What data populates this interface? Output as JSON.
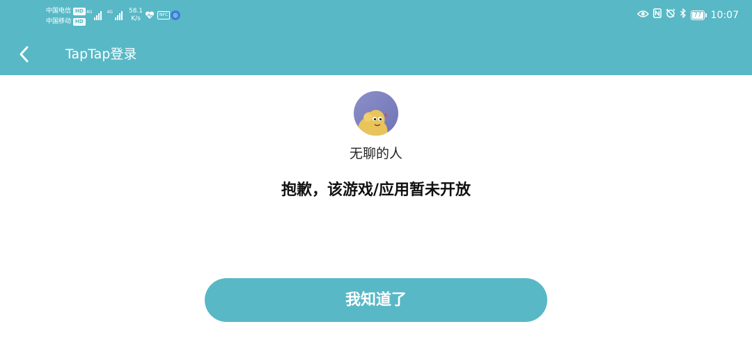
{
  "status_bar": {
    "carrier1": "中国电信",
    "carrier2": "中国移动",
    "hd_badge": "HD",
    "network_type": "4G",
    "speed_value": "58.1",
    "speed_unit": "K/s",
    "nfc_badge": "NFC",
    "battery_level": "77",
    "time": "10:07"
  },
  "nav": {
    "title": "TapTap登录"
  },
  "profile": {
    "username": "无聊的人"
  },
  "message": "抱歉，该游戏/应用暂未开放",
  "confirm_button_label": "我知道了",
  "colors": {
    "accent": "#59b8c6",
    "background": "#ffffff",
    "text_primary": "#111111"
  }
}
